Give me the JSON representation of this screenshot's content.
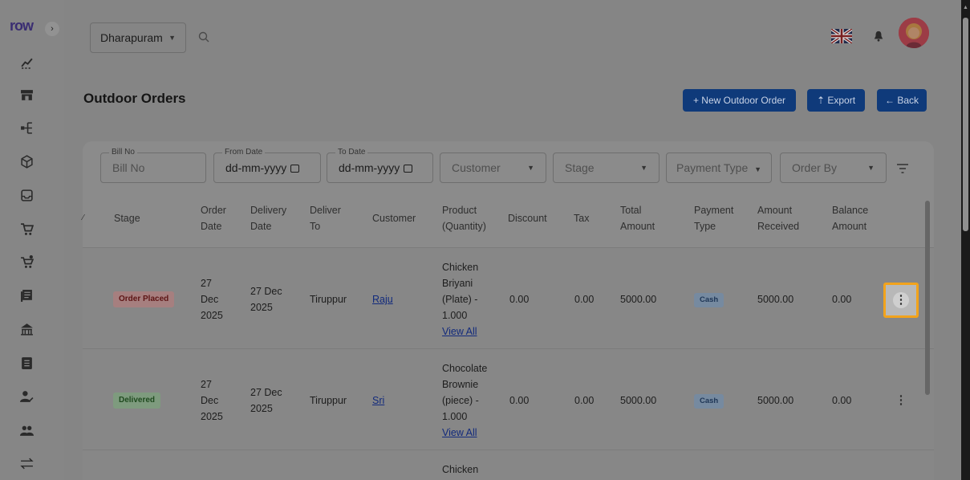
{
  "app": {
    "brand": "row"
  },
  "topbar": {
    "location": "Dharapuram",
    "search_icon": "search-icon",
    "flag_icon": "uk-flag-icon",
    "bell_icon": "bell-icon"
  },
  "page": {
    "title": "Outdoor Orders",
    "buttons": {
      "new_order": "+  New Outdoor Order",
      "export": "⇡  Export",
      "back": "←  Back"
    }
  },
  "filters": {
    "bill_no": {
      "legend": "Bill No",
      "placeholder": "Bill No"
    },
    "from_date": {
      "legend": "From Date",
      "value": "dd-mm-yyyy"
    },
    "to_date": {
      "legend": "To Date",
      "value": "dd-mm-yyyy"
    },
    "customer": "Customer",
    "stage": "Stage",
    "payment_type": "Payment Type",
    "order_by": "Order By"
  },
  "table": {
    "headers": {
      "stage": "Stage",
      "order_date": [
        "Order",
        "Date"
      ],
      "delivery_date": [
        "Delivery",
        "Date"
      ],
      "deliver_to": [
        "Deliver",
        "To"
      ],
      "customer": "Customer",
      "product": [
        "Product",
        "(Quantity)"
      ],
      "discount": "Discount",
      "tax": "Tax",
      "total_amount": [
        "Total",
        "Amount"
      ],
      "payment_type": [
        "Payment",
        "Type"
      ],
      "amount_received": [
        "Amount",
        "Received"
      ],
      "balance_amount": [
        "Balance",
        "Amount"
      ]
    },
    "rows": [
      {
        "stage": "Order Placed",
        "order_date": [
          "27",
          "Dec",
          "2025"
        ],
        "delivery_date": [
          "27 Dec",
          "2025"
        ],
        "deliver_to": "Tiruppur",
        "customer": "Raju",
        "product": [
          "Chicken",
          "Briyani",
          "(Plate) -",
          "1.000"
        ],
        "view_all": "View All",
        "discount": "0.00",
        "tax": "0.00",
        "total_amount": "5000.00",
        "payment_type": "Cash",
        "amount_received": "5000.00",
        "balance_amount": "0.00"
      },
      {
        "stage": "Delivered",
        "order_date": [
          "27",
          "Dec",
          "2025"
        ],
        "delivery_date": [
          "27 Dec",
          "2025"
        ],
        "deliver_to": "Tiruppur",
        "customer": "Sri",
        "product": [
          "Chocolate",
          "Brownie",
          "(piece) -",
          "1.000"
        ],
        "view_all": "View All",
        "discount": "0.00",
        "tax": "0.00",
        "total_amount": "5000.00",
        "payment_type": "Cash",
        "amount_received": "5000.00",
        "balance_amount": "0.00"
      },
      {
        "product": [
          "Chicken"
        ]
      }
    ]
  },
  "colors": {
    "primary_button": "#0f3a7a",
    "highlight": "#f2a31c",
    "badge_order_placed": "#a67f7f",
    "badge_delivered": "#7e9b7e"
  }
}
